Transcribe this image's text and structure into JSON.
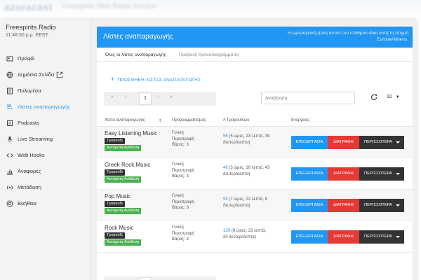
{
  "topbar": {
    "brand": "azuracast",
    "tagline": "Freespirits Web Radio Service"
  },
  "station": {
    "name": "Freespirits Radio",
    "time": "11:48:30 μ.μ. EEST"
  },
  "sidebar": {
    "items": [
      {
        "label": "Προφίλ",
        "icon": "profile-icon"
      },
      {
        "label": "Δημόσια Σελίδα",
        "icon": "globe-icon"
      },
      {
        "label": "Πολυμέσα",
        "icon": "media-icon"
      },
      {
        "label": "Λίστες αναπαραγωγής",
        "icon": "playlist-icon",
        "active": true
      },
      {
        "label": "Podcasts",
        "icon": "podcast-icon"
      },
      {
        "label": "Live Streaming",
        "icon": "microphone-icon"
      },
      {
        "label": "Web Hooks",
        "icon": "code-icon"
      },
      {
        "label": "Αναφορές",
        "icon": "chart-icon"
      },
      {
        "label": "Μετάδοση",
        "icon": "broadcast-icon"
      },
      {
        "label": "Βοήθεια",
        "icon": "help-icon"
      }
    ]
  },
  "header": {
    "title": "Λίστες αναπαραγωγής",
    "timezone_notice_1": "Η ωρολογιακή ζώνη αυτού του σταθμού είναι αυτή τη στιγμή",
    "timezone_notice_2": "Europe/Athens."
  },
  "tabs": [
    "Όλες οι λίστες αναπαραγωγής",
    "Προβολή Χρονοδιαγράμματος"
  ],
  "add_button": "ΠΡΟΣΘΗΚΗ ΛΙΣΤΑΣ ΑΝΑΠΑΡΑΓΩΓΗΣ",
  "pager": {
    "first": "«",
    "prev": "‹",
    "current": "1",
    "next": "›",
    "last": "»"
  },
  "search": {
    "placeholder": "Αναζήτηση"
  },
  "per_page": "10",
  "table": {
    "headers": [
      "Λίστα αναπαραγωγής",
      "Προγραμματισμός",
      "# Τραγουδιών",
      "Ενέργειες"
    ],
    "sort_mark": "⇕",
    "actions": {
      "edit": "ΕΠΕΞΕΡΓΑΣΙΑ",
      "delete": "ΔΙΑΓΡΑΦΗ",
      "more": "ΠΕΡΙΣΣΟΤΕΡΑ"
    },
    "rows": [
      {
        "name": "Easy Listening Music",
        "type_badge": "Τραγούδι",
        "auto_badge": "Αυτόματη Ανάθεση",
        "sched_1": "Γενική",
        "sched_2": "Περιστροφή",
        "sched_3": "Βάρος: 3",
        "count": "56",
        "dur_1": "(5 ώρες, 23 λεπτά, 39",
        "dur_2": "δευτερόλεπτα)"
      },
      {
        "name": "Greek Rock Music",
        "type_badge": "Τραγούδι",
        "auto_badge": "Αυτόματη Ανάθεση",
        "sched_1": "Γενική",
        "sched_2": "Περιστροφή",
        "sched_3": "Βάρος: 3",
        "count": "46",
        "dur_1": "(3 ώρες, 16 λεπτά, 43",
        "dur_2": "δευτερόλεπτα)"
      },
      {
        "name": "Pop Music",
        "type_badge": "Τραγούδι",
        "auto_badge": "Αυτόματη Ανάθεση",
        "sched_1": "Γενική",
        "sched_2": "Περιστροφή",
        "sched_3": "Βάρος: 3",
        "count": "95",
        "dur_1": "(7 ώρες, 22 λεπτά, 9",
        "dur_2": "δευτερόλεπτα)"
      },
      {
        "name": "Rock Music",
        "type_badge": "Τραγούδι",
        "auto_badge": "Αυτόματη Ανάθεση",
        "sched_1": "Γενική",
        "sched_2": "Περιστροφή",
        "sched_3": "Βάρος: 3",
        "count": "129",
        "dur_1": "(9 ώρες, 23 λεπτά,",
        "dur_2": "20 δευτερόλεπτα)"
      }
    ]
  },
  "colors": {
    "primary": "#2196f3",
    "danger": "#e53935",
    "dark": "#333333",
    "success": "#4caf50"
  }
}
